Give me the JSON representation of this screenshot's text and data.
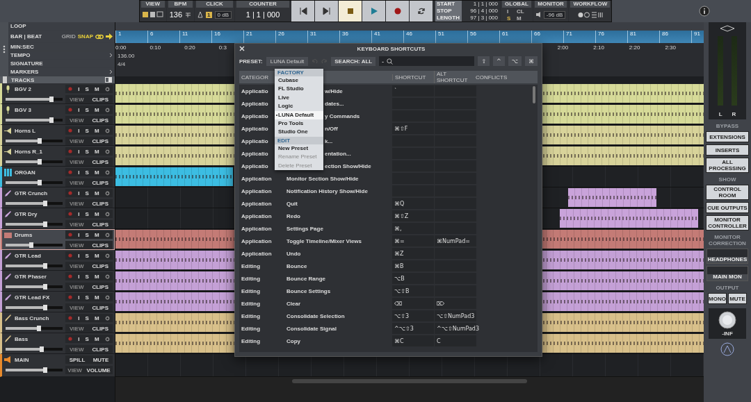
{
  "transport": {
    "view_label": "VIEW",
    "bpm_label": "BPM",
    "bpm": "136",
    "click_label": "CLICK",
    "click_count": "1",
    "click_level": "0 dB",
    "counter_label": "COUNTER",
    "counter": "1 | 1 | 000",
    "buttons": [
      {
        "kind": "rewind",
        "on": false
      },
      {
        "kind": "forward",
        "on": false
      },
      {
        "kind": "stop",
        "on": true
      },
      {
        "kind": "play",
        "on": false
      },
      {
        "kind": "record",
        "on": false
      },
      {
        "kind": "loop",
        "on": false
      }
    ],
    "range": [
      {
        "label": "START",
        "value": "1 | 1 | 000"
      },
      {
        "label": "STOP",
        "value": "96 | 4 | 000"
      },
      {
        "label": "LENGTH",
        "value": "97 | 3 | 000"
      }
    ],
    "global_label": "GLOBAL",
    "global_keys": [
      "I",
      "CL",
      "S",
      "M"
    ],
    "monitor_label": "MONITOR",
    "monitor_level": "-96 dB",
    "workflow_label": "WORKFLOW"
  },
  "rulers": {
    "loop": "LOOP",
    "bar_beat": "BAR | BEAT",
    "grid": "GRID",
    "snap": "SNAP",
    "min_sec": "MIN:SEC",
    "tempo": "TEMPO",
    "signature": "SIGNATURE",
    "markers": "MARKERS",
    "tracks": "TRACKS",
    "bars": [
      "1",
      "6",
      "11",
      "16",
      "21",
      "26",
      "31",
      "36",
      "41",
      "46",
      "51",
      "56",
      "61",
      "66",
      "71",
      "76",
      "81",
      "86",
      "91"
    ],
    "times_left": [
      "0:00",
      "0:10",
      "0:20",
      "0:3"
    ],
    "times_right": [
      "2:00",
      "2:10",
      "2:20",
      "2:30"
    ],
    "tempo_value": "136.00",
    "signature_value": "4/4"
  },
  "tracks": [
    {
      "name": "BGV 2",
      "kind": "vocal",
      "color": "#d6da98",
      "level": 0.8,
      "selected": false,
      "input": "I",
      "solo": "S",
      "mute": "M",
      "view": "VIEW",
      "clips": "CLIPS"
    },
    {
      "name": "BGV 3",
      "kind": "vocal",
      "color": "#d6da98",
      "level": 0.8,
      "selected": false,
      "input": "I",
      "solo": "S",
      "mute": "M",
      "view": "VIEW",
      "clips": "CLIPS"
    },
    {
      "name": "Horns L",
      "kind": "horn",
      "color": "#d8d39a",
      "level": 0.6,
      "selected": false,
      "input": "I",
      "solo": "S",
      "mute": "M",
      "view": "VIEW",
      "clips": "CLIPS"
    },
    {
      "name": "Horns R_1",
      "kind": "horn",
      "color": "#d8d39a",
      "level": 0.6,
      "selected": false,
      "input": "I",
      "solo": "S",
      "mute": "M",
      "view": "VIEW",
      "clips": "CLIPS"
    },
    {
      "name": "ORGAN",
      "kind": "keys",
      "color": "#3cbde2",
      "level": 0.6,
      "selected": false,
      "input": "I",
      "solo": "S",
      "mute": "M",
      "view": "VIEW",
      "clips": "CLIPS"
    },
    {
      "name": "GTR Crunch",
      "kind": "guitar",
      "color": "#c9a3da",
      "level": 0.7,
      "selected": false,
      "input": "I",
      "solo": "S",
      "mute": "M",
      "view": "VIEW",
      "clips": "CLIPS"
    },
    {
      "name": "GTR Dry",
      "kind": "guitar",
      "color": "#c9a3da",
      "level": 0.7,
      "selected": false,
      "input": "I",
      "solo": "S",
      "mute": "M",
      "view": "VIEW",
      "clips": "CLIPS"
    },
    {
      "name": "Drums",
      "kind": "drums",
      "color": "#c47b76",
      "level": 0.45,
      "selected": true,
      "input": "I",
      "solo": "S",
      "mute": "M",
      "view": "VIEW",
      "clips": "CLIPS"
    },
    {
      "name": "GTR Lead",
      "kind": "guitar",
      "color": "#c4a0d6",
      "level": 0.7,
      "selected": false,
      "input": "I",
      "solo": "S",
      "mute": "M",
      "view": "VIEW",
      "clips": "CLIPS"
    },
    {
      "name": "GTR Phaser",
      "kind": "guitar",
      "color": "#c4a0d6",
      "level": 0.7,
      "selected": false,
      "input": "I",
      "solo": "S",
      "mute": "M",
      "view": "VIEW",
      "clips": "CLIPS"
    },
    {
      "name": "GTR Lead FX",
      "kind": "guitar",
      "color": "#c4a0d6",
      "level": 0.7,
      "selected": false,
      "input": "I",
      "solo": "S",
      "mute": "M",
      "view": "VIEW",
      "clips": "CLIPS"
    },
    {
      "name": "Bass Crunch",
      "kind": "bass",
      "color": "#d8c08a",
      "level": 0.58,
      "selected": false,
      "input": "I",
      "solo": "S",
      "mute": "M",
      "view": "VIEW",
      "clips": "CLIPS"
    },
    {
      "name": "Bass",
      "kind": "bass",
      "color": "#d8c08a",
      "level": 0.64,
      "selected": false,
      "input": "I",
      "solo": "S",
      "mute": "M",
      "view": "VIEW",
      "clips": "CLIPS"
    }
  ],
  "main_track": {
    "name": "MAIN",
    "spill": "SPILL",
    "mute": "MUTE",
    "view": "VIEW",
    "volume": "VOLUME",
    "level": 0.7
  },
  "dialog": {
    "title": "KEYBOARD SHORTCUTS",
    "preset_label": "PRESET:",
    "preset": "LUNA Default",
    "search": "SEARCH: ALL",
    "search_prefix": "-",
    "modifiers": [
      "⇧",
      "^",
      "⌥",
      "⌘"
    ],
    "columns": [
      "CATEGOR",
      "SHORTCUT",
      "ALT SHORTCUT",
      "CONFLICTS"
    ],
    "rows": [
      {
        "category": "Applicatio",
        "command": "w/Hide",
        "shortcut": "`",
        "alt": "",
        "covered": true
      },
      {
        "category": "Applicatio",
        "command": "dates...",
        "shortcut": "",
        "alt": "",
        "covered": true
      },
      {
        "category": "Applicatio",
        "command": "y Commands",
        "shortcut": "",
        "alt": "",
        "covered": true
      },
      {
        "category": "Applicatio",
        "command": "n/Off",
        "shortcut": "⌘⇧F",
        "alt": "",
        "covered": true
      },
      {
        "category": "Applicatio",
        "command": "k...",
        "shortcut": "",
        "alt": "",
        "covered": true
      },
      {
        "category": "Applicatio",
        "command": "entation...",
        "shortcut": "",
        "alt": "",
        "covered": true
      },
      {
        "category": "Applicatio",
        "command": "ection Show/Hide",
        "shortcut": "",
        "alt": "",
        "covered": true
      },
      {
        "category": "Application",
        "command": "Monitor Section Show/Hide",
        "shortcut": "",
        "alt": "",
        "covered": false
      },
      {
        "category": "Application",
        "command": "Notification History Show/Hide",
        "shortcut": "",
        "alt": "",
        "covered": false
      },
      {
        "category": "Application",
        "command": "Quit",
        "shortcut": "⌘Q",
        "alt": "",
        "covered": false
      },
      {
        "category": "Application",
        "command": "Redo",
        "shortcut": "⌘⇧Z",
        "alt": "",
        "covered": false
      },
      {
        "category": "Application",
        "command": "Settings Page",
        "shortcut": "⌘,",
        "alt": "",
        "covered": false
      },
      {
        "category": "Application",
        "command": "Toggle Timeline/Mixer Views",
        "shortcut": "⌘=",
        "alt": "⌘NumPad=",
        "covered": false
      },
      {
        "category": "Application",
        "command": "Undo",
        "shortcut": "⌘Z",
        "alt": "",
        "covered": false
      },
      {
        "category": "Editing",
        "command": "Bounce",
        "shortcut": "⌘B",
        "alt": "",
        "covered": false
      },
      {
        "category": "Editing",
        "command": "Bounce Range",
        "shortcut": "⌥B",
        "alt": "",
        "covered": false
      },
      {
        "category": "Editing",
        "command": "Bounce Settings",
        "shortcut": "⌥⇧B",
        "alt": "",
        "covered": false
      },
      {
        "category": "Editing",
        "command": "Clear",
        "shortcut": "⌫",
        "alt": "⌦",
        "covered": false
      },
      {
        "category": "Editing",
        "command": "Consolidate Selection",
        "shortcut": "⌥⇧3",
        "alt": "⌥⇧NumPad3",
        "covered": false
      },
      {
        "category": "Editing",
        "command": "Consolidate Signal",
        "shortcut": "^⌥⇧3",
        "alt": "^⌥⇧NumPad3",
        "covered": false
      },
      {
        "category": "Editing",
        "command": "Copy",
        "shortcut": "⌘C",
        "alt": "C",
        "covered": false
      }
    ],
    "menu": [
      {
        "label": "FACTORY",
        "kind": "header"
      },
      {
        "label": "Cubase",
        "kind": "item",
        "selected": false,
        "disabled": false
      },
      {
        "label": "FL Studio",
        "kind": "item",
        "selected": false,
        "disabled": false
      },
      {
        "label": "Live",
        "kind": "item",
        "selected": false,
        "disabled": false
      },
      {
        "label": "Logic",
        "kind": "item",
        "selected": false,
        "disabled": false
      },
      {
        "label": "LUNA Default",
        "kind": "item",
        "selected": true,
        "disabled": false
      },
      {
        "label": "Pro Tools",
        "kind": "item",
        "selected": false,
        "disabled": false
      },
      {
        "label": "Studio One",
        "kind": "item",
        "selected": false,
        "disabled": false
      },
      {
        "label": "EDIT",
        "kind": "header"
      },
      {
        "label": "New Preset",
        "kind": "item",
        "selected": false,
        "disabled": false
      },
      {
        "label": "Rename Preset",
        "kind": "item",
        "selected": false,
        "disabled": true
      },
      {
        "label": "Delete Preset",
        "kind": "item",
        "selected": false,
        "disabled": true
      }
    ]
  },
  "monitor": {
    "left": "L",
    "right": "R",
    "bypass": "BYPASS",
    "bypass_buttons": [
      "EXTENSIONS",
      "INSERTS",
      "ALL PROCESSING"
    ],
    "show": "SHOW",
    "show_buttons": [
      "CONTROL ROOM",
      "CUE OUTPUTS",
      "MONITOR CONTROLLER"
    ],
    "correction": "MONITOR CORRECTION",
    "correction_buttons": [
      "HEADPHONES",
      "MAIN MON"
    ],
    "output": "OUTPUT",
    "output_buttons": [
      "MONO",
      "MUTE"
    ],
    "volume": "-INF"
  }
}
